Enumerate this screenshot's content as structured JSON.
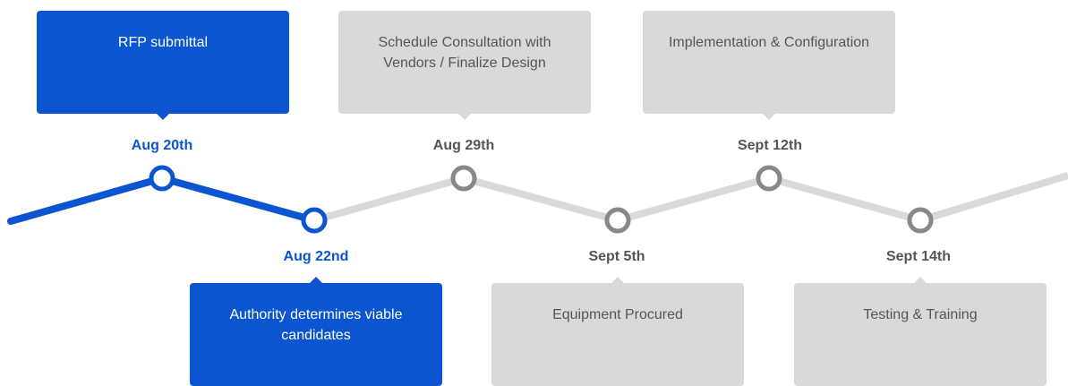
{
  "colors": {
    "active": "#0b55d1",
    "pending_line": "#d9d9d9",
    "pending_node": "#888888",
    "pending_text": "#555555"
  },
  "milestones": [
    {
      "date": "Aug 20th",
      "label": "RFP submittal",
      "status": "complete",
      "position": "top"
    },
    {
      "date": "Aug 22nd",
      "label": "Authority determines viable candidates",
      "status": "complete",
      "position": "bottom"
    },
    {
      "date": "Aug 29th",
      "label": "Schedule Consultation with Vendors / Finalize Design",
      "status": "pending",
      "position": "top"
    },
    {
      "date": "Sept 5th",
      "label": "Equipment Procured",
      "status": "pending",
      "position": "bottom"
    },
    {
      "date": "Sept 12th",
      "label": "Implementation & Configuration",
      "status": "pending",
      "position": "top"
    },
    {
      "date": "Sept 14th",
      "label": "Testing & Training",
      "status": "pending",
      "position": "bottom"
    }
  ]
}
